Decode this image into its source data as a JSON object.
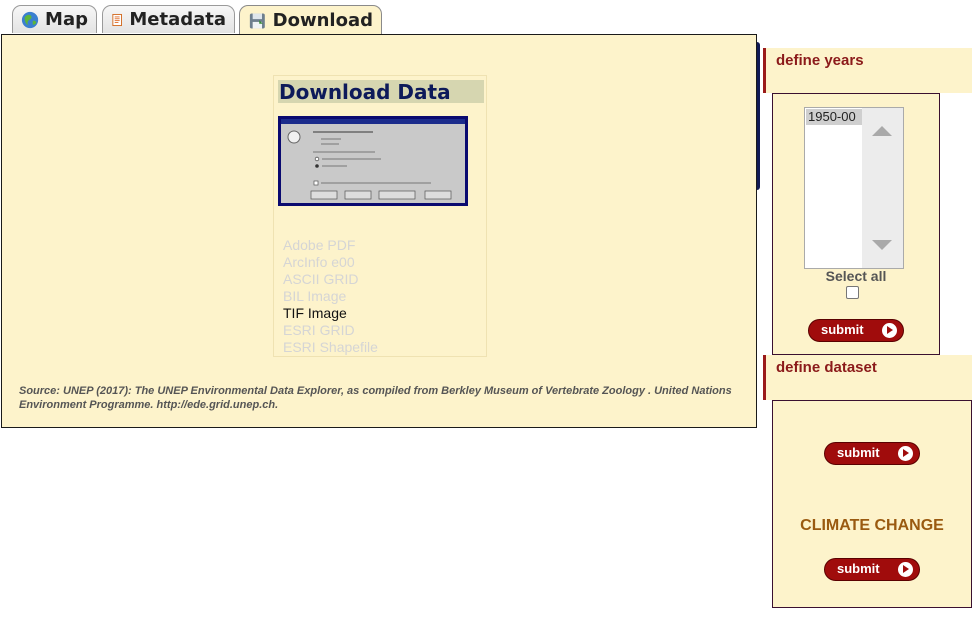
{
  "tabs": [
    {
      "label": "Map",
      "icon": "globe-icon"
    },
    {
      "label": "Metadata",
      "icon": "document-icon"
    },
    {
      "label": "Download",
      "icon": "disk-icon",
      "active": true
    }
  ],
  "download": {
    "title": "Download Data",
    "formats": [
      "Adobe PDF",
      "ArcInfo e00",
      "ASCII GRID",
      "BIL Image",
      "TIF Image",
      "ESRI GRID",
      "ESRI Shapefile"
    ],
    "active_format": "TIF Image",
    "source": "Source: UNEP (2017): The UNEP Environmental Data Explorer, as compiled from Berkley Museum of Vertebrate Zoology . United Nations Environment Programme. http://ede.grid.unep.ch."
  },
  "years": {
    "heading": "define years",
    "options": [
      "1950-00"
    ],
    "select_all_label": "Select all",
    "submit_label": "submit"
  },
  "dataset": {
    "heading": "define dataset",
    "submit_label": "submit",
    "category": "CLIMATE CHANGE",
    "submit2_label": "submit"
  },
  "colors": {
    "panel": "#fdf3cb",
    "accent": "#a00c0c",
    "title": "#0d1a5a"
  }
}
